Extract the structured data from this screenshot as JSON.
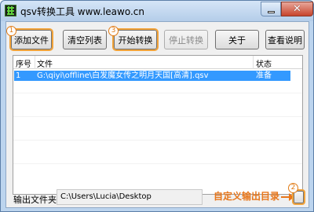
{
  "window": {
    "title": "qsv转换工具 www.leawo.cn"
  },
  "toolbar": {
    "add_files": "添加文件",
    "clear_list": "清空列表",
    "start_convert": "开始转换",
    "stop_convert": "停止转换",
    "about": "关于",
    "help": "查看说明"
  },
  "steps": {
    "step1": "1",
    "step2": "2",
    "step3": "3"
  },
  "file_list": {
    "columns": [
      "序号",
      "文件",
      "状态"
    ],
    "rows": [
      {
        "index": "1",
        "file": "G:\\qiyi\\offline\\白发魔女传之明月天国[高清].qsv",
        "status": "准备"
      }
    ]
  },
  "output": {
    "label": "输出文件夹：",
    "path": "C:\\Users\\Lucia\\Desktop",
    "annotation": "自定义输出目录"
  },
  "colors": {
    "accent_orange": "#e8761a",
    "selection_blue": "#3399ff"
  }
}
